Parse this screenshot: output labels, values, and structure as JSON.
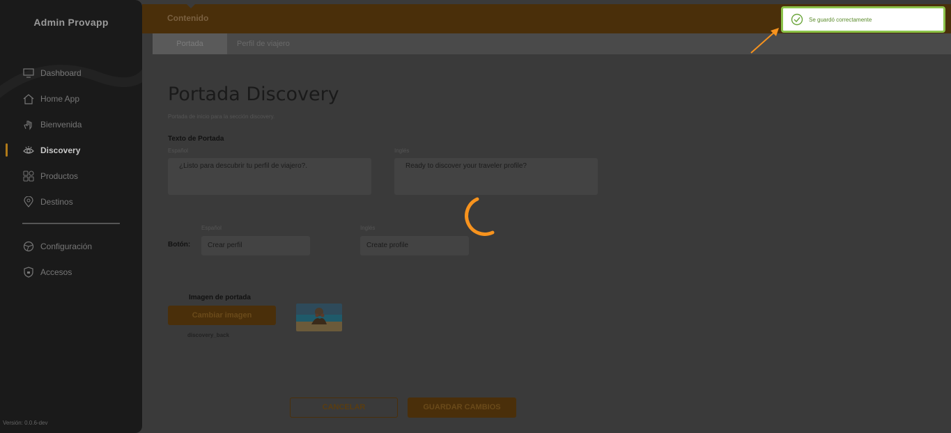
{
  "sidebar": {
    "app_title": "Admin Provapp",
    "items": [
      {
        "label": "Dashboard",
        "icon": "monitor-icon"
      },
      {
        "label": "Home App",
        "icon": "home-icon"
      },
      {
        "label": "Bienvenida",
        "icon": "hand-icon"
      },
      {
        "label": "Discovery",
        "icon": "eye-icon",
        "active": true
      },
      {
        "label": "Productos",
        "icon": "grid-icon"
      },
      {
        "label": "Destinos",
        "icon": "location-pin-icon"
      }
    ],
    "items_secondary": [
      {
        "label": "Configuración",
        "icon": "settings-icon"
      },
      {
        "label": "Accesos",
        "icon": "shield-icon"
      }
    ],
    "version": "Versión: 0.0.6-dev"
  },
  "header": {
    "title": "Contenido",
    "tabs": [
      {
        "label": "Portada",
        "active": true
      },
      {
        "label": "Perfil de viajero",
        "active": false
      }
    ]
  },
  "main": {
    "title": "Portada Discovery",
    "subtitle": "Portada de inicio para la sección discovery.",
    "cover_text": {
      "label": "Texto de Portada",
      "es_label": "Español",
      "en_label": "Inglés",
      "es_value": "¿Listo para descubrir tu perfil de viajero?.",
      "en_value": "Ready to discover your traveler profile?"
    },
    "button_text": {
      "label": "Botón:",
      "es_label": "Español",
      "en_label": "Inglés",
      "es_value": "Crear perfil",
      "en_value": "Create profile"
    },
    "image": {
      "label": "Imagen de portada",
      "change_button": "Cambiar imagen",
      "file_name": "discovery_back"
    },
    "actions": {
      "cancel": "CANCELAR",
      "save": "GUARDAR CAMBIOS"
    }
  },
  "toast": {
    "message": "Se guardó correctamente",
    "icon": "check-circle-icon",
    "border_color": "#8bc34a"
  },
  "colors": {
    "accent": "#f7931e",
    "success": "#8bc34a"
  }
}
